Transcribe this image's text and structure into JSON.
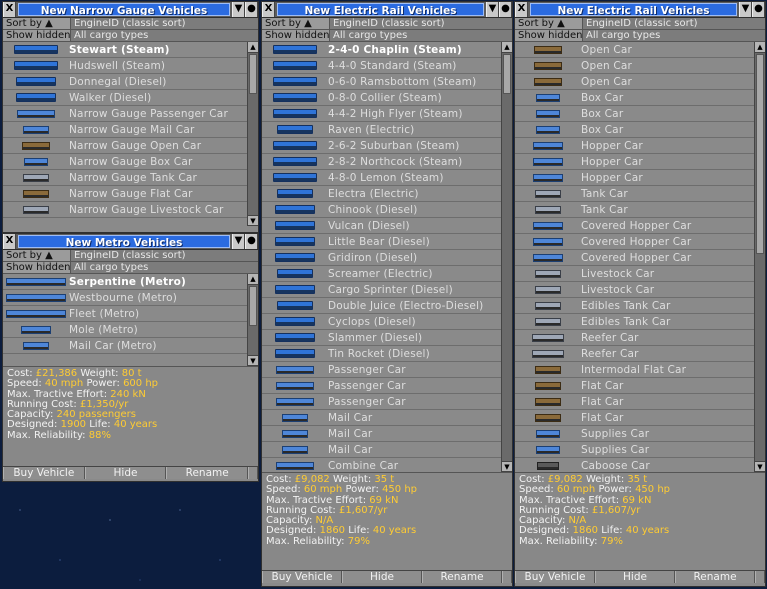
{
  "common": {
    "sort_by": "Sort by ▲",
    "show_hidden": "Show hidden",
    "sort_value": "EngineID (classic sort)",
    "cargo_filter": "All cargo types",
    "buttons": {
      "buy": "Buy Vehicle",
      "hide": "Hide",
      "rename": "Rename"
    },
    "title_buttons": {
      "close": "X",
      "shade": "▼",
      "sticky": "●",
      "pin": "⊥"
    }
  },
  "narrow_gauge": {
    "title": "New Narrow Gauge Vehicles",
    "items": [
      {
        "name": "Stewart (Steam)",
        "icon": "steam-loco"
      },
      {
        "name": "Hudswell (Steam)",
        "icon": "steam-loco"
      },
      {
        "name": "Donnegal (Diesel)",
        "icon": "diesel-loco"
      },
      {
        "name": "Walker (Diesel)",
        "icon": "diesel-loco"
      },
      {
        "name": "Narrow Gauge Passenger Car",
        "icon": "passenger-car"
      },
      {
        "name": "Narrow Gauge Mail Car",
        "icon": "mail-car"
      },
      {
        "name": "Narrow Gauge Open Car",
        "icon": "open-car"
      },
      {
        "name": "Narrow Gauge Box Car",
        "icon": "box-car"
      },
      {
        "name": "Narrow Gauge Tank Car",
        "icon": "tank-car"
      },
      {
        "name": "Narrow Gauge Flat Car",
        "icon": "flat-car"
      },
      {
        "name": "Narrow Gauge Livestock Car",
        "icon": "livestock-car"
      }
    ]
  },
  "metro": {
    "title": "New Metro Vehicles",
    "items": [
      {
        "name": "Serpentine (Metro)",
        "icon": "metro-train"
      },
      {
        "name": "Westbourne (Metro)",
        "icon": "metro-train"
      },
      {
        "name": "Fleet (Metro)",
        "icon": "metro-train"
      },
      {
        "name": "Mole (Metro)",
        "icon": "metro-loco"
      },
      {
        "name": "Mail Car (Metro)",
        "icon": "mail-car"
      }
    ],
    "info": {
      "cost_label": "Cost:",
      "cost": "£21,386",
      "weight_label": "Weight:",
      "weight": "80 t",
      "speed_label": "Speed:",
      "speed": "40 mph",
      "power_label": "Power:",
      "power": "600 hp",
      "effort_label": "Max. Tractive Effort:",
      "effort": "240 kN",
      "running_label": "Running Cost:",
      "running": "£1,350/yr",
      "capacity_label": "Capacity:",
      "capacity": "240 passengers",
      "designed_label": "Designed:",
      "designed": "1900",
      "life_label": "Life:",
      "life": "40 years",
      "reliability_label": "Max. Reliability:",
      "reliability": "88%"
    }
  },
  "electric_1": {
    "title": "New Electric Rail Vehicles",
    "items": [
      {
        "name": "2-4-0 Chaplin (Steam)",
        "icon": "steam-loco"
      },
      {
        "name": "4-4-0 Standard (Steam)",
        "icon": "steam-loco"
      },
      {
        "name": "0-6-0 Ramsbottom (Steam)",
        "icon": "steam-loco"
      },
      {
        "name": "0-8-0 Collier (Steam)",
        "icon": "steam-loco"
      },
      {
        "name": "4-4-2 High Flyer (Steam)",
        "icon": "steam-loco"
      },
      {
        "name": "Raven (Electric)",
        "icon": "electric-loco"
      },
      {
        "name": "2-6-2 Suburban (Steam)",
        "icon": "steam-loco"
      },
      {
        "name": "2-8-2 Northcock (Steam)",
        "icon": "steam-loco"
      },
      {
        "name": "4-8-0 Lemon (Steam)",
        "icon": "steam-loco"
      },
      {
        "name": "Electra (Electric)",
        "icon": "electric-loco"
      },
      {
        "name": "Chinook (Diesel)",
        "icon": "diesel-loco"
      },
      {
        "name": "Vulcan (Diesel)",
        "icon": "diesel-loco"
      },
      {
        "name": "Little Bear (Diesel)",
        "icon": "diesel-loco"
      },
      {
        "name": "Gridiron (Diesel)",
        "icon": "diesel-loco"
      },
      {
        "name": "Screamer (Electric)",
        "icon": "electric-loco"
      },
      {
        "name": "Cargo Sprinter (Diesel)",
        "icon": "diesel-loco"
      },
      {
        "name": "Double Juice (Electro-Diesel)",
        "icon": "electric-loco"
      },
      {
        "name": "Cyclops (Diesel)",
        "icon": "diesel-loco"
      },
      {
        "name": "Slammer (Diesel)",
        "icon": "diesel-loco"
      },
      {
        "name": "Tin Rocket (Diesel)",
        "icon": "diesel-loco"
      },
      {
        "name": "Passenger Car",
        "icon": "passenger-car"
      },
      {
        "name": "Passenger Car",
        "icon": "passenger-car"
      },
      {
        "name": "Passenger Car",
        "icon": "passenger-car"
      },
      {
        "name": "Mail Car",
        "icon": "mail-car"
      },
      {
        "name": "Mail Car",
        "icon": "mail-car"
      },
      {
        "name": "Mail Car",
        "icon": "mail-car"
      },
      {
        "name": "Combine Car",
        "icon": "passenger-car"
      }
    ],
    "info": {
      "cost_label": "Cost:",
      "cost": "£9,082",
      "weight_label": "Weight:",
      "weight": "35 t",
      "speed_label": "Speed:",
      "speed": "60 mph",
      "power_label": "Power:",
      "power": "450 hp",
      "effort_label": "Max. Tractive Effort:",
      "effort": "69 kN",
      "running_label": "Running Cost:",
      "running": "£1,607/yr",
      "capacity_label": "Capacity:",
      "capacity": "N/A",
      "designed_label": "Designed:",
      "designed": "1860",
      "life_label": "Life:",
      "life": "40 years",
      "reliability_label": "Max. Reliability:",
      "reliability": "79%"
    }
  },
  "electric_2": {
    "title": "New Electric Rail Vehicles",
    "items": [
      {
        "name": "Open Car",
        "icon": "open-car"
      },
      {
        "name": "Open Car",
        "icon": "open-car"
      },
      {
        "name": "Open Car",
        "icon": "open-car"
      },
      {
        "name": "Box Car",
        "icon": "box-car"
      },
      {
        "name": "Box Car",
        "icon": "box-car"
      },
      {
        "name": "Box Car",
        "icon": "box-car"
      },
      {
        "name": "Hopper Car",
        "icon": "hopper-car"
      },
      {
        "name": "Hopper Car",
        "icon": "hopper-car"
      },
      {
        "name": "Hopper Car",
        "icon": "hopper-car"
      },
      {
        "name": "Tank Car",
        "icon": "tank-car"
      },
      {
        "name": "Tank Car",
        "icon": "tank-car"
      },
      {
        "name": "Covered Hopper Car",
        "icon": "hopper-car"
      },
      {
        "name": "Covered Hopper Car",
        "icon": "hopper-car"
      },
      {
        "name": "Covered Hopper Car",
        "icon": "hopper-car"
      },
      {
        "name": "Livestock Car",
        "icon": "livestock-car"
      },
      {
        "name": "Livestock Car",
        "icon": "livestock-car"
      },
      {
        "name": "Edibles Tank Car",
        "icon": "tank-car"
      },
      {
        "name": "Edibles Tank Car",
        "icon": "tank-car"
      },
      {
        "name": "Reefer Car",
        "icon": "reefer-car"
      },
      {
        "name": "Reefer Car",
        "icon": "reefer-car"
      },
      {
        "name": "Intermodal Flat Car",
        "icon": "flat-car"
      },
      {
        "name": "Flat Car",
        "icon": "flat-car"
      },
      {
        "name": "Flat Car",
        "icon": "flat-car"
      },
      {
        "name": "Flat Car",
        "icon": "flat-car"
      },
      {
        "name": "Supplies Car",
        "icon": "box-car"
      },
      {
        "name": "Supplies Car",
        "icon": "box-car"
      },
      {
        "name": "Caboose Car",
        "icon": "caboose-car"
      }
    ],
    "info": {
      "cost_label": "Cost:",
      "cost": "£9,082",
      "weight_label": "Weight:",
      "weight": "35 t",
      "speed_label": "Speed:",
      "speed": "60 mph",
      "power_label": "Power:",
      "power": "450 hp",
      "effort_label": "Max. Tractive Effort:",
      "effort": "69 kN",
      "running_label": "Running Cost:",
      "running": "£1,607/yr",
      "capacity_label": "Capacity:",
      "capacity": "N/A",
      "designed_label": "Designed:",
      "designed": "1860",
      "life_label": "Life:",
      "life": "40 years",
      "reliability_label": "Max. Reliability:",
      "reliability": "79%"
    }
  }
}
